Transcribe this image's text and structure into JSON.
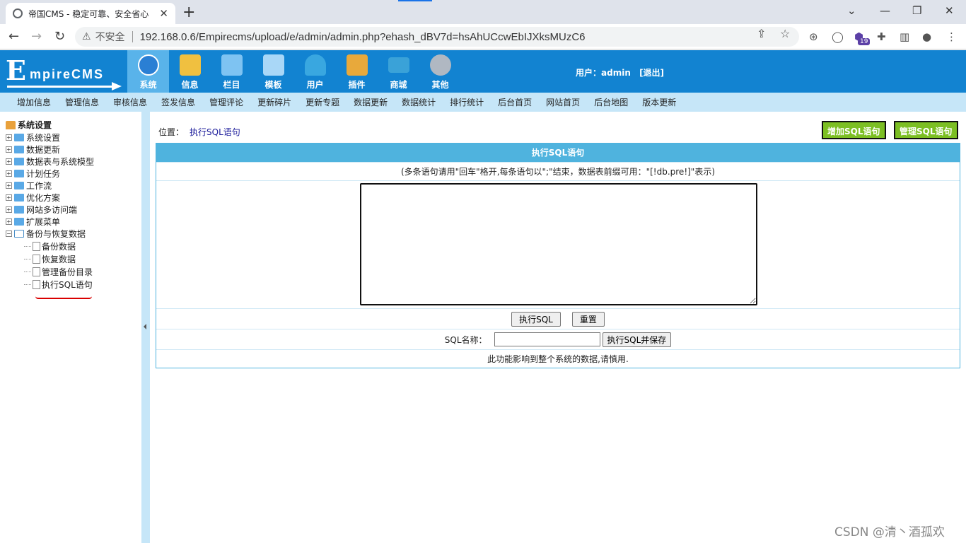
{
  "browser": {
    "tab_title": "帝国CMS - 稳定可靠、安全省心",
    "insecure_label": "不安全",
    "url": "192.168.0.6/Empirecms/upload/e/admin/admin.php?ehash_dBV7d=hsAhUCcwEbIJXksMUzC6",
    "extension_badge": "19"
  },
  "header": {
    "logo_e": "E",
    "logo_text": "mpireCMS",
    "menu": [
      {
        "label": "系统",
        "active": true,
        "color": "#2a7fd4"
      },
      {
        "label": "信息",
        "color": "#f0c040"
      },
      {
        "label": "栏目",
        "color": "#7ec3f2"
      },
      {
        "label": "模板",
        "color": "#a9d7f7"
      },
      {
        "label": "用户",
        "color": "#39a7e0"
      },
      {
        "label": "插件",
        "color": "#e8a93b"
      },
      {
        "label": "商城",
        "color": "#3aa2d8"
      },
      {
        "label": "其他",
        "color": "#b0b8c2"
      }
    ],
    "user_label": "用户：",
    "user_name": "admin",
    "logout": "[退出]"
  },
  "subnav": [
    "增加信息",
    "管理信息",
    "审核信息",
    "签发信息",
    "管理评论",
    "更新碎片",
    "更新专题",
    "数据更新",
    "数据统计",
    "排行统计",
    "后台首页",
    "网站首页",
    "后台地图",
    "版本更新"
  ],
  "sidebar": {
    "root": "系统设置",
    "nodes": [
      "系统设置",
      "数据更新",
      "数据表与系统模型",
      "计划任务",
      "工作流",
      "优化方案",
      "网站多访问端",
      "扩展菜单"
    ],
    "open_node": "备份与恢复数据",
    "children": [
      "备份数据",
      "恢复数据",
      "管理备份目录",
      "执行SQL语句"
    ]
  },
  "main": {
    "location_label": "位置：",
    "location_link": "执行SQL语句",
    "add_sql_button": "增加SQL语句",
    "manage_sql_button": "管理SQL语句",
    "panel_title": "执行SQL语句",
    "hint": "(多条语句请用\"回车\"格开,每条语句以\";\"结束，数据表前缀可用：\"[!db.pre!]\"表示)",
    "execute_button": "执行SQL",
    "reset_button": "重置",
    "sql_name_label": "SQL名称：",
    "sql_name_value": "",
    "save_execute_button": "执行SQL并保存",
    "warning": "此功能影响到整个系统的数据,请慎用."
  },
  "watermark": "CSDN @清丶酒孤欢",
  "colors": {
    "header_bg": "#1283d1",
    "subnav_bg": "#c6e6f8",
    "panel_head": "#4fb3de",
    "green_button": "#7cbf23"
  }
}
